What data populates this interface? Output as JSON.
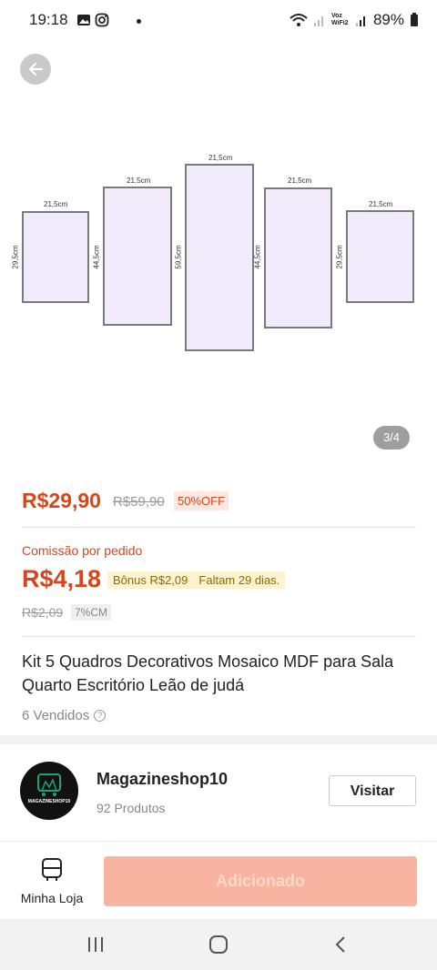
{
  "status_bar": {
    "time": "19:18",
    "network_label": "Voz WiFi2",
    "battery": "89%"
  },
  "image": {
    "counter": "3/4",
    "panels": [
      {
        "width_label": "21,5cm",
        "height_label": "29,5cm"
      },
      {
        "width_label": "21,5cm",
        "height_label": "44,5cm"
      },
      {
        "width_label": "21,5cm",
        "height_label": "59,5cm"
      },
      {
        "width_label": "21,5cm",
        "height_label": "44,5cm"
      },
      {
        "width_label": "21,5cm",
        "height_label": "29,5cm"
      }
    ]
  },
  "price": {
    "current": "R$29,90",
    "original": "R$59,90",
    "discount": "50%OFF"
  },
  "commission": {
    "label": "Comissão por pedido",
    "value": "R$4,18",
    "bonus": "Bônus R$2,09",
    "remaining": "Faltam 29 dias.",
    "old_value": "R$2,09",
    "rate": "7%CM"
  },
  "product": {
    "title": "Kit 5 Quadros Decorativos Mosaico MDF para Sala Quarto Escritório Leão de judá",
    "sold": "6 Vendidos"
  },
  "store": {
    "name": "Magazineshop10",
    "products": "92 Produtos",
    "visit_label": "Visitar",
    "logo_text": "MAGAZINESHOP10"
  },
  "bottom": {
    "my_shop_label": "Minha Loja",
    "add_label": "Adicionado"
  },
  "colors": {
    "accent": "#d9451b",
    "add_button": "#f8b4a0",
    "panel_fill": "#f1ebfb"
  }
}
